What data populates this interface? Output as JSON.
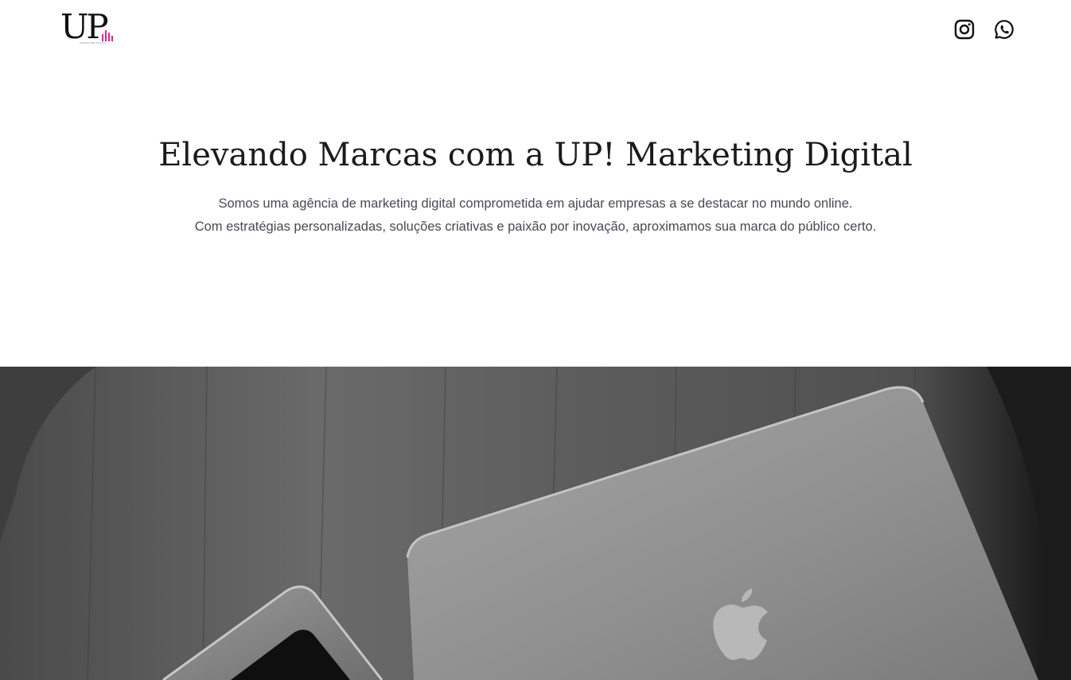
{
  "header": {
    "logo": {
      "text": "UP",
      "tagline": "MARKETING DIGITAL"
    },
    "social": [
      {
        "name": "instagram",
        "icon": "instagram-icon"
      },
      {
        "name": "whatsapp",
        "icon": "whatsapp-icon"
      }
    ]
  },
  "hero": {
    "title": "Elevando Marcas com a UP! Marketing Digital",
    "paragraph_line1": "Somos uma agência de marketing digital comprometida em ajudar empresas a se destacar no mundo online.",
    "paragraph_line2": "Com estratégias personalizadas, soluções criativas e paixão por inovação, aproximamos sua marca do público certo."
  },
  "image": {
    "description_icon": "laptop-phone-photo"
  },
  "colors": {
    "brand_accent": "#e4208b",
    "text_dark": "#1b1b1b",
    "text_body": "#444a52"
  }
}
